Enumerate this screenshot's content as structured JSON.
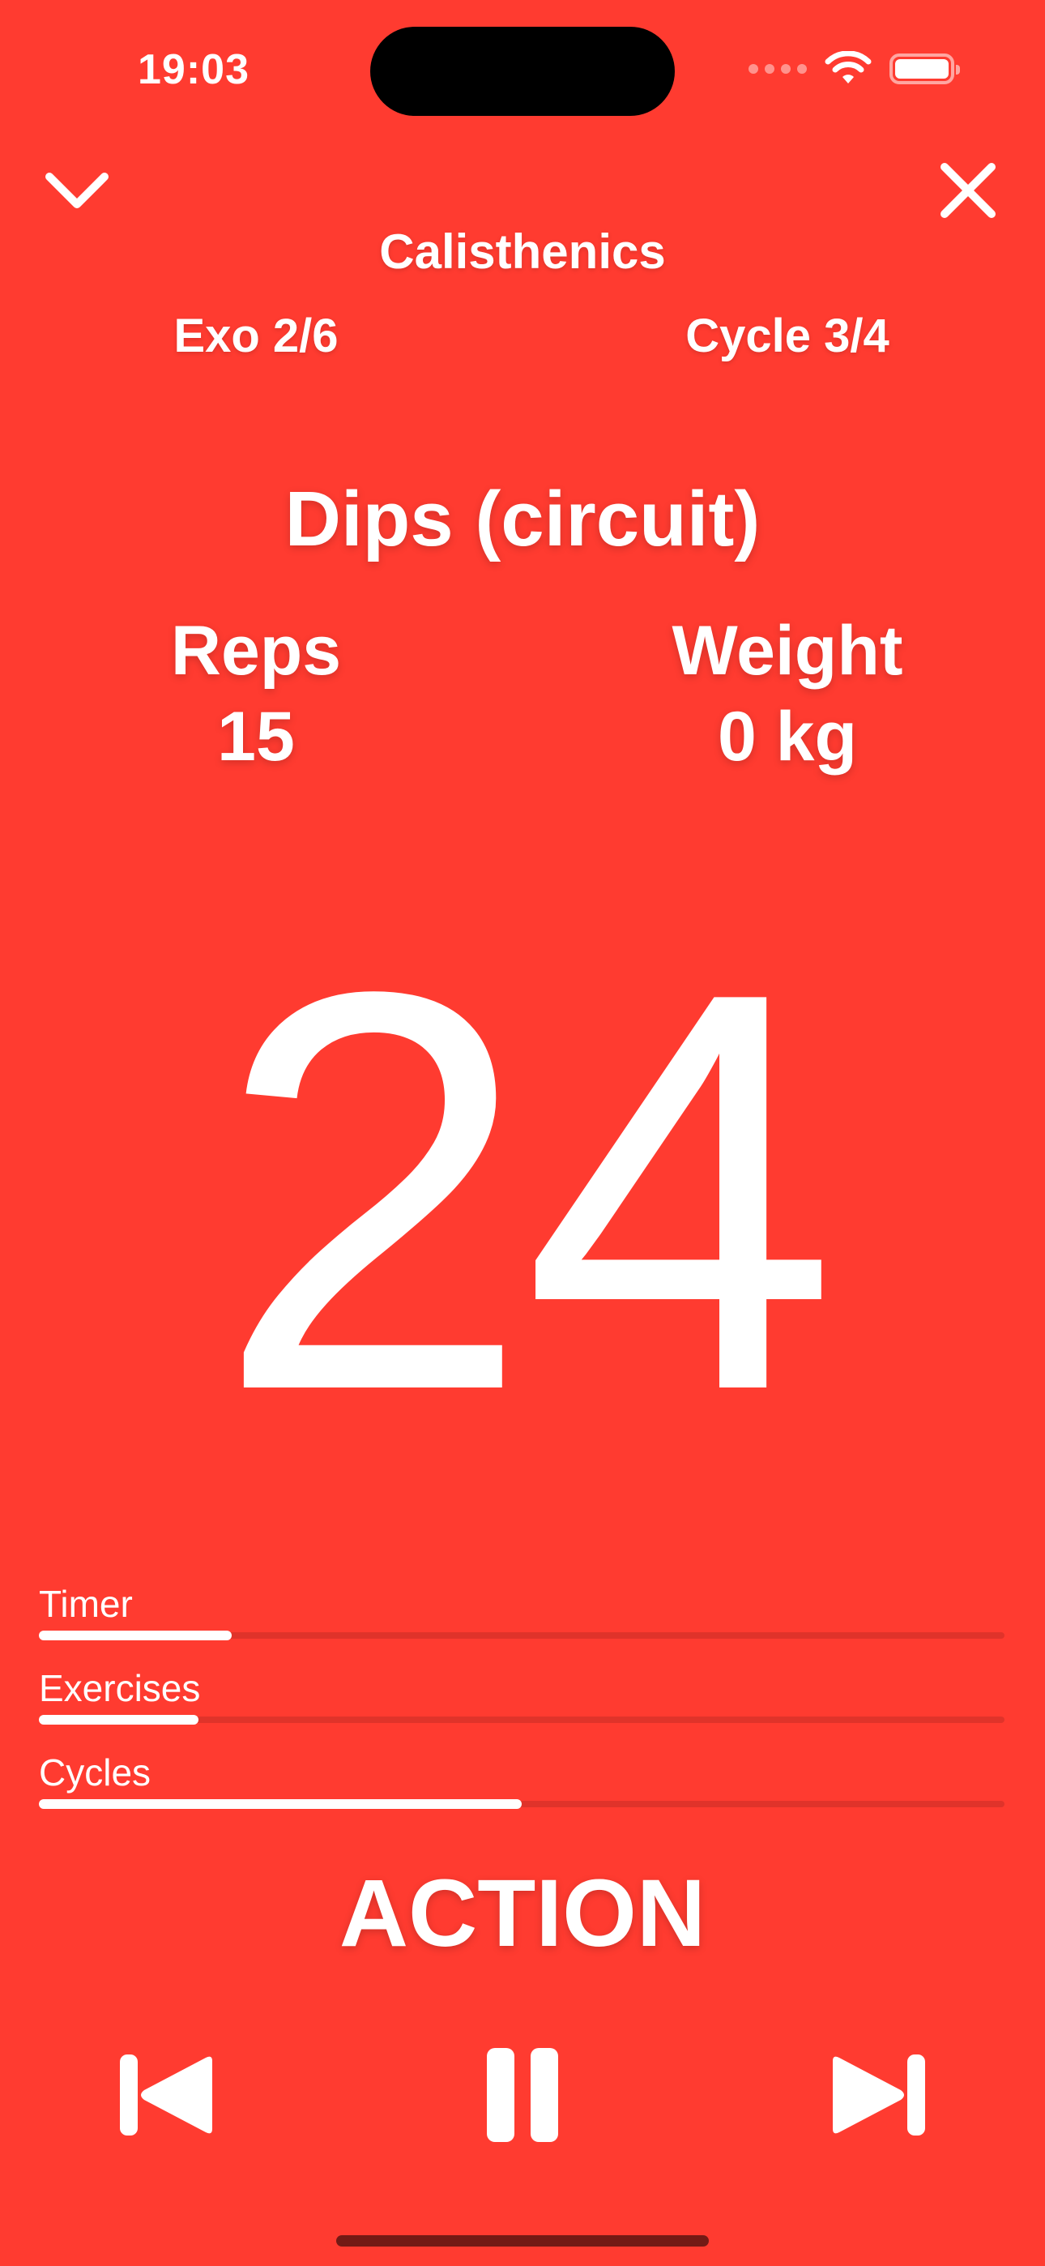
{
  "status_bar": {
    "time": "19:03",
    "icons": [
      "signal-dots-icon",
      "wifi-icon",
      "battery-icon"
    ]
  },
  "header": {
    "collapse_icon": "chevron-down-icon",
    "close_icon": "close-icon",
    "workout_title": "Calisthenics",
    "exercise_counter": "Exo 2/6",
    "cycle_counter": "Cycle 3/4"
  },
  "exercise": {
    "name": "Dips (circuit)",
    "reps_label": "Reps",
    "reps_value": "15",
    "weight_label": "Weight",
    "weight_value": "0 kg"
  },
  "timer": {
    "countdown": "24"
  },
  "progress": [
    {
      "label": "Timer",
      "fraction": 0.2
    },
    {
      "label": "Exercises",
      "fraction": 0.165
    },
    {
      "label": "Cycles",
      "fraction": 0.5
    }
  ],
  "phase": "ACTION",
  "controls": {
    "previous_icon": "skip-backward-icon",
    "pause_icon": "pause-icon",
    "next_icon": "skip-forward-icon"
  },
  "colors": {
    "background": "#FF3B30",
    "foreground": "#FFFFFF"
  }
}
